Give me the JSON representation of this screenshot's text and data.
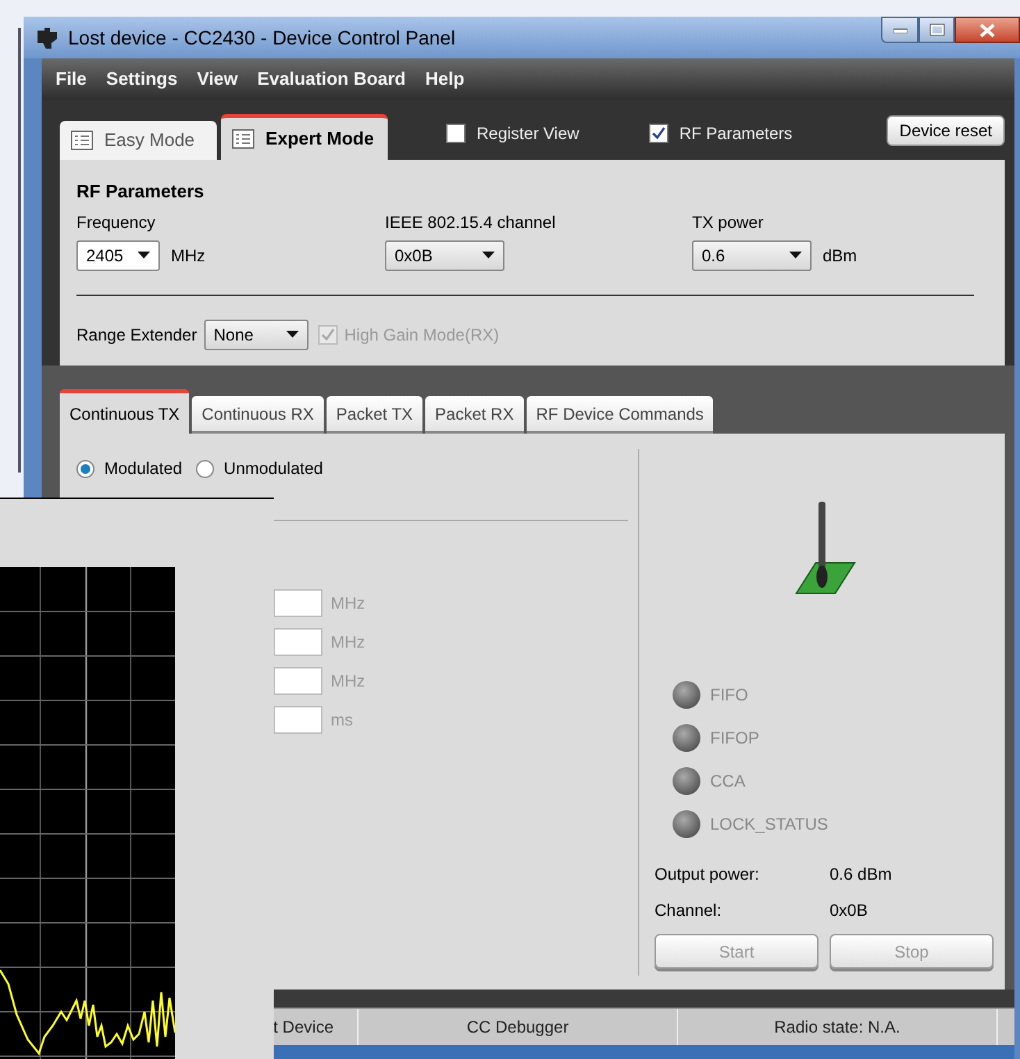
{
  "window": {
    "title": "Lost device - CC2430 - Device Control Panel"
  },
  "menu": [
    "File",
    "Settings",
    "View",
    "Evaluation Board",
    "Help"
  ],
  "mode_tabs": [
    {
      "label": "Easy Mode",
      "selected": false
    },
    {
      "label": "Expert Mode",
      "selected": true
    }
  ],
  "view_options": [
    {
      "label": "Register View",
      "checked": false
    },
    {
      "label": "RF Parameters",
      "checked": true
    }
  ],
  "device_reset": "Device reset",
  "rf_parameters": {
    "heading": "RF Parameters",
    "frequency": {
      "label": "Frequency",
      "value": "2405",
      "unit": "MHz"
    },
    "channel": {
      "label": "IEEE 802.15.4 channel",
      "value": "0x0B"
    },
    "tx_power": {
      "label": "TX power",
      "value": "0.6",
      "unit": "dBm"
    },
    "range_extender": {
      "label": "Range Extender",
      "value": "None"
    },
    "high_gain": {
      "label": "High Gain Mode(RX)",
      "checked": true,
      "disabled": true
    }
  },
  "test_tabs": [
    {
      "label": "Continuous TX",
      "selected": true
    },
    {
      "label": "Continuous RX",
      "selected": false
    },
    {
      "label": "Packet TX",
      "selected": false
    },
    {
      "label": "Packet RX",
      "selected": false
    },
    {
      "label": "RF Device Commands",
      "selected": false
    }
  ],
  "modulation": [
    {
      "label": "Modulated",
      "selected": true
    },
    {
      "label": "Unmodulated",
      "selected": false
    }
  ],
  "fields": [
    {
      "unit": "MHz"
    },
    {
      "unit": "MHz"
    },
    {
      "unit": "MHz"
    },
    {
      "unit": "ms"
    }
  ],
  "leds": [
    {
      "label": "FIFO",
      "on": false
    },
    {
      "label": "FIFOP",
      "on": false
    },
    {
      "label": "CCA",
      "on": false
    },
    {
      "label": "LOCK_STATUS",
      "on": false
    }
  ],
  "readouts": [
    {
      "label": "Output power:",
      "value": "0.6 dBm"
    },
    {
      "label": "Channel:",
      "value": "0x0B"
    }
  ],
  "buttons": [
    {
      "label": "Start",
      "disabled": true
    },
    {
      "label": "Stop",
      "disabled": true
    }
  ],
  "status_bar": [
    "t Device",
    "CC Debugger",
    "Radio state: N.A."
  ]
}
